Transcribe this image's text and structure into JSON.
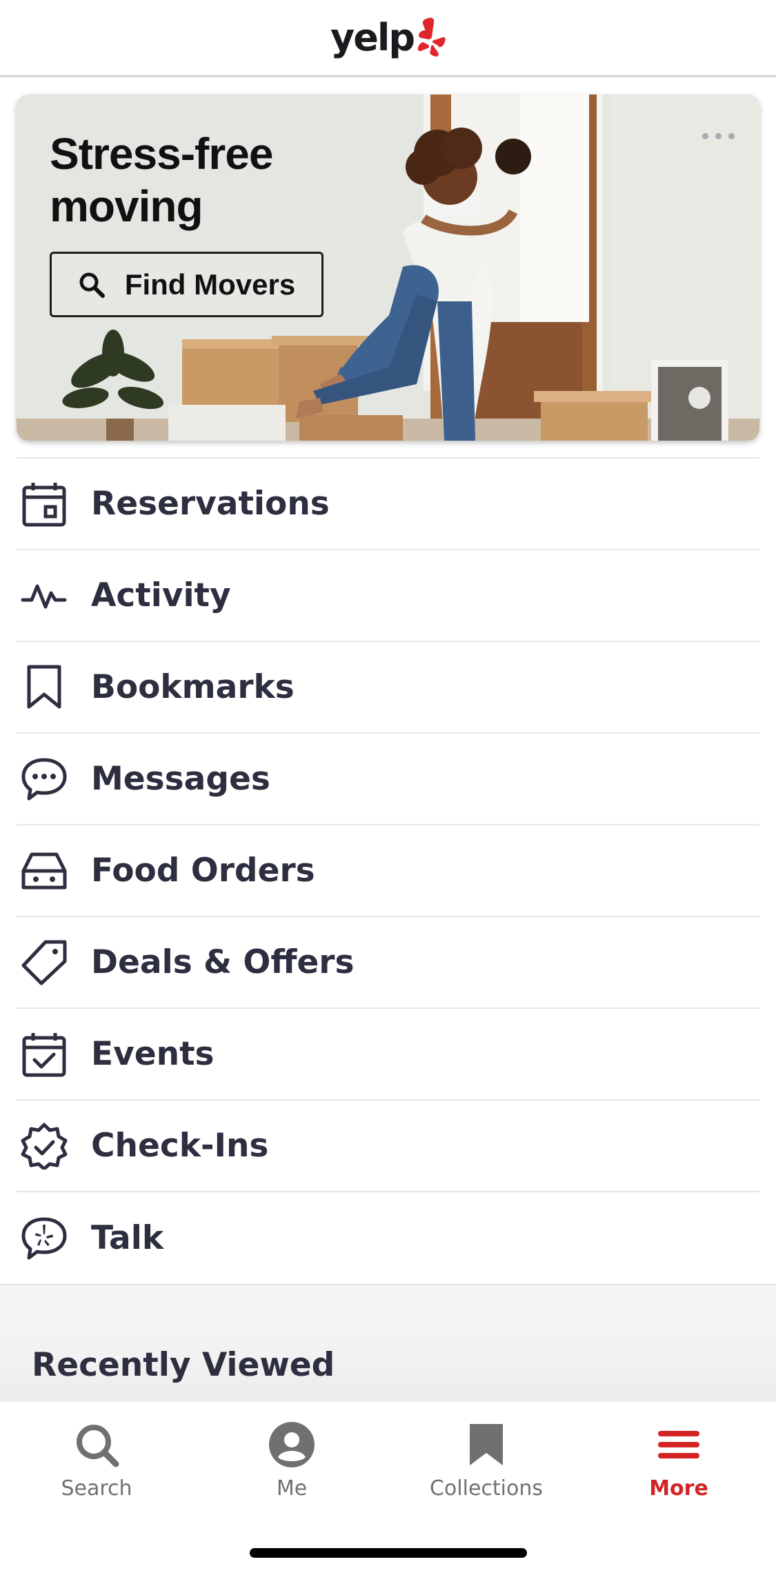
{
  "header": {
    "logo_text": "yelp",
    "logo_icon": "yelp-burst-icon",
    "brand_color": "#d32323"
  },
  "promo": {
    "title": "Stress-free moving",
    "button_label": "Find Movers",
    "button_icon": "search-icon",
    "more_icon": "more-dots-icon"
  },
  "menu": {
    "items": [
      {
        "label": "Reservations",
        "icon": "calendar-icon"
      },
      {
        "label": "Activity",
        "icon": "activity-icon"
      },
      {
        "label": "Bookmarks",
        "icon": "bookmark-icon"
      },
      {
        "label": "Messages",
        "icon": "message-icon"
      },
      {
        "label": "Food Orders",
        "icon": "food-orders-icon"
      },
      {
        "label": "Deals & Offers",
        "icon": "tag-icon"
      },
      {
        "label": "Events",
        "icon": "event-check-icon"
      },
      {
        "label": "Check-Ins",
        "icon": "check-badge-icon"
      },
      {
        "label": "Talk",
        "icon": "talk-icon"
      }
    ]
  },
  "recent": {
    "title": "Recently Viewed"
  },
  "tabbar": {
    "tabs": [
      {
        "label": "Search",
        "icon": "search-icon",
        "active": false
      },
      {
        "label": "Me",
        "icon": "user-icon",
        "active": false
      },
      {
        "label": "Collections",
        "icon": "bookmark-icon",
        "active": false
      },
      {
        "label": "More",
        "icon": "menu-icon",
        "active": true
      }
    ],
    "active_color": "#d32323",
    "inactive_color": "#6e7072"
  }
}
